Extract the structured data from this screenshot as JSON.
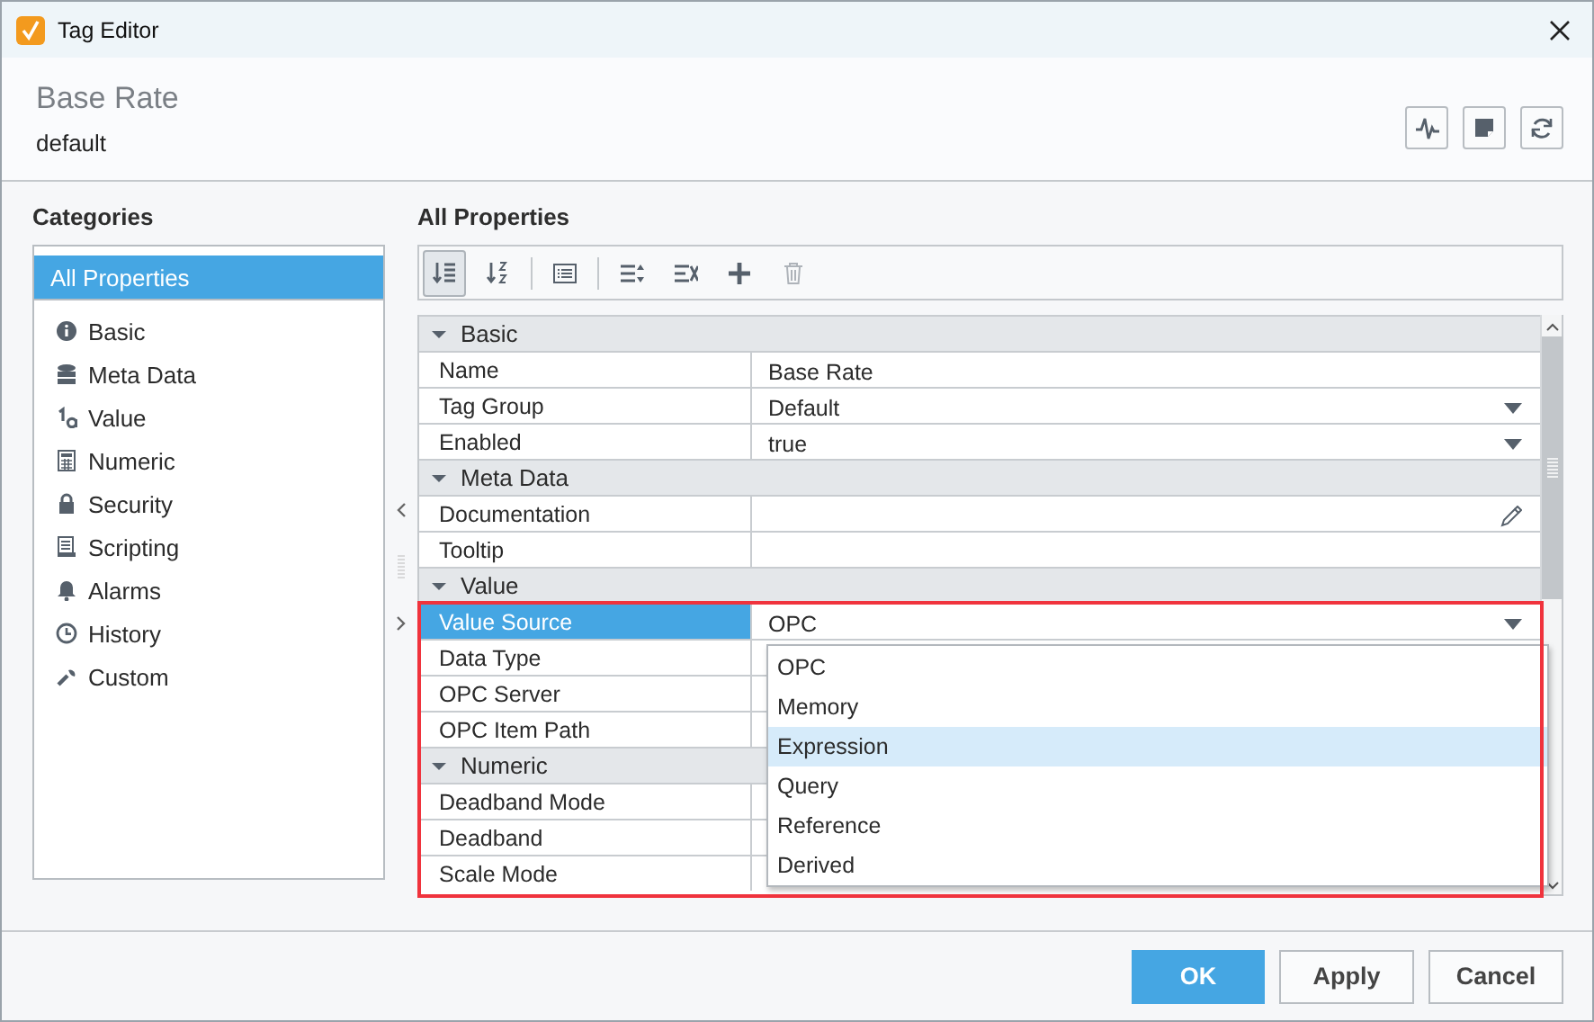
{
  "window": {
    "title": "Tag Editor"
  },
  "header": {
    "tag_name": "Base Rate",
    "provider": "default",
    "tools": [
      {
        "kind": "chart"
      },
      {
        "kind": "note"
      },
      {
        "kind": "refresh"
      }
    ]
  },
  "categories": {
    "title": "Categories",
    "items": [
      {
        "label": "All Properties",
        "selected": true
      },
      {
        "label": "Basic",
        "selected": false
      },
      {
        "label": "Meta Data",
        "selected": false
      },
      {
        "label": "Value",
        "selected": false
      },
      {
        "label": "Numeric",
        "selected": false
      },
      {
        "label": "Security",
        "selected": false
      },
      {
        "label": "Scripting",
        "selected": false
      },
      {
        "label": "Alarms",
        "selected": false
      },
      {
        "label": "History",
        "selected": false
      },
      {
        "label": "Custom",
        "selected": false
      }
    ]
  },
  "properties": {
    "title": "All Properties",
    "toolbar": [
      {
        "kind": "sort-category",
        "selected": true,
        "disabled": false
      },
      {
        "kind": "sort-alpha",
        "selected": false,
        "disabled": false
      },
      {
        "kind": "separator"
      },
      {
        "kind": "description",
        "selected": false,
        "disabled": false
      },
      {
        "kind": "separator"
      },
      {
        "kind": "expand",
        "selected": false,
        "disabled": false
      },
      {
        "kind": "collapse",
        "selected": false,
        "disabled": false
      },
      {
        "kind": "add",
        "selected": false,
        "disabled": false
      },
      {
        "kind": "delete",
        "selected": false,
        "disabled": true
      }
    ],
    "rows": [
      {
        "kind": "section",
        "label": "Basic",
        "expanded": true
      },
      {
        "kind": "text",
        "name": "Name",
        "value": "Base Rate",
        "selected": false
      },
      {
        "kind": "dropdown",
        "name": "Tag Group",
        "value": "Default",
        "selected": false
      },
      {
        "kind": "dropdown",
        "name": "Enabled",
        "value": "true",
        "selected": false
      },
      {
        "kind": "section",
        "label": "Meta Data",
        "expanded": true
      },
      {
        "kind": "editable",
        "name": "Documentation",
        "selected": false
      },
      {
        "kind": "text",
        "name": "Tooltip",
        "selected": false
      },
      {
        "kind": "section",
        "label": "Value",
        "expanded": true
      },
      {
        "kind": "dropdown",
        "name": "Value Source",
        "value": "OPC",
        "selected": true
      },
      {
        "kind": "text",
        "name": "Data Type",
        "selected": false
      },
      {
        "kind": "text",
        "name": "OPC Server",
        "selected": false
      },
      {
        "kind": "text",
        "name": "OPC Item Path",
        "selected": false
      },
      {
        "kind": "section",
        "label": "Numeric",
        "expanded": true
      },
      {
        "kind": "text",
        "name": "Deadband Mode",
        "selected": false
      },
      {
        "kind": "text",
        "name": "Deadband",
        "selected": false
      },
      {
        "kind": "text",
        "name": "Scale Mode",
        "selected": false
      }
    ],
    "dropdown": {
      "highlighted": true,
      "options": [
        {
          "label": "OPC",
          "selected": false
        },
        {
          "label": "Memory",
          "selected": false
        },
        {
          "label": "Expression",
          "selected": true
        },
        {
          "label": "Query",
          "selected": false
        },
        {
          "label": "Reference",
          "selected": false
        },
        {
          "label": "Derived",
          "selected": false
        }
      ]
    }
  },
  "buttons": [
    {
      "label": "OK",
      "primary": true
    },
    {
      "label": "Apply",
      "primary": false
    },
    {
      "label": "Cancel",
      "primary": false
    }
  ]
}
